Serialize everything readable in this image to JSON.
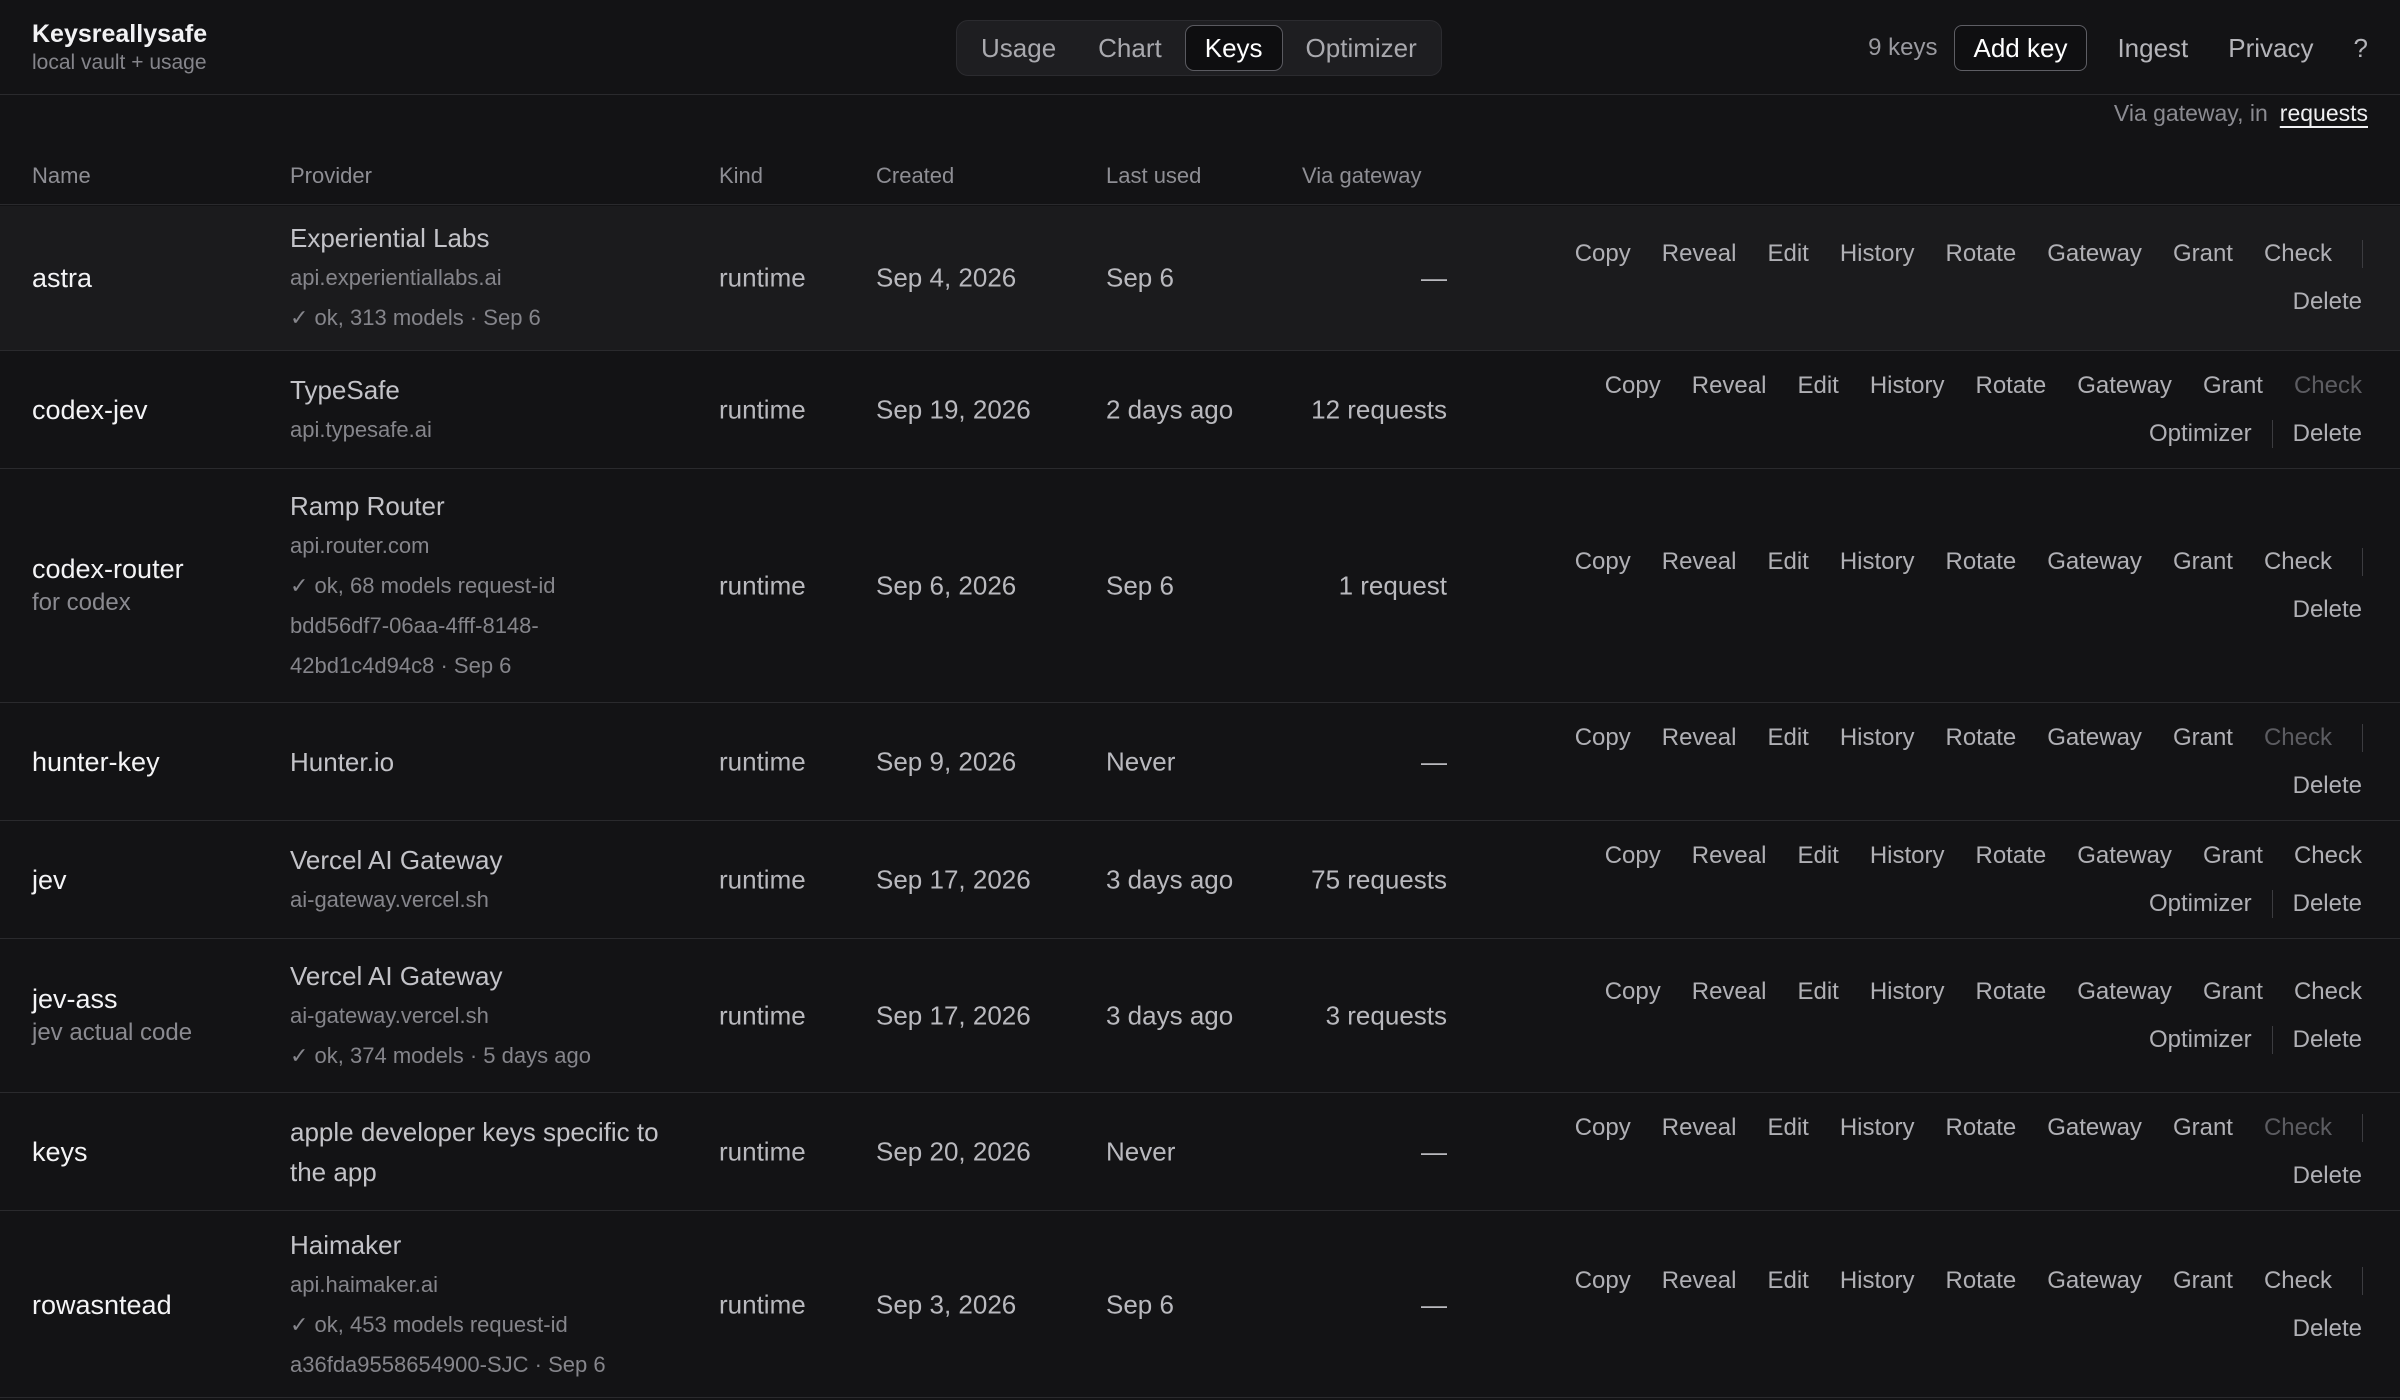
{
  "app": {
    "title": "Keysreallysafe",
    "subtitle": "local vault + usage"
  },
  "tabs": [
    {
      "label": "Usage",
      "active": false
    },
    {
      "label": "Chart",
      "active": false
    },
    {
      "label": "Keys",
      "active": true
    },
    {
      "label": "Optimizer",
      "active": false
    }
  ],
  "nav": {
    "key_count": "9 keys",
    "add_key": "Add key",
    "ingest": "Ingest",
    "privacy": "Privacy",
    "help": "?"
  },
  "gateway_hint": {
    "prefix": "Via gateway, in",
    "unit": "requests"
  },
  "columns": [
    "Name",
    "Provider",
    "Kind",
    "Created",
    "Last used",
    "Via gateway"
  ],
  "actions": {
    "copy": "Copy",
    "reveal": "Reveal",
    "edit": "Edit",
    "history": "History",
    "rotate": "Rotate",
    "gateway": "Gateway",
    "grant": "Grant",
    "check": "Check",
    "optimizer": "Optimizer",
    "delete": "Delete"
  },
  "rows": [
    {
      "name": "astra",
      "note": "",
      "provider": "Experiential Labs",
      "provider_lines": [
        "api.experientiallabs.ai",
        "✓ ok, 313 models · Sep 6"
      ],
      "kind": "runtime",
      "created": "Sep 4, 2026",
      "last_used": "Sep 6",
      "via": "—",
      "check_enabled": true,
      "optimizer": false
    },
    {
      "name": "codex-jev",
      "note": "",
      "provider": "TypeSafe",
      "provider_lines": [
        "api.typesafe.ai"
      ],
      "kind": "runtime",
      "created": "Sep 19, 2026",
      "last_used": "2 days ago",
      "via": "12 requests",
      "check_enabled": false,
      "optimizer": true
    },
    {
      "name": "codex-router",
      "note": "for codex",
      "provider": "Ramp Router",
      "provider_lines": [
        "api.router.com",
        "✓ ok, 68 models request-id",
        "bdd56df7-06aa-4fff-8148-",
        "42bd1c4d94c8 · Sep 6"
      ],
      "kind": "runtime",
      "created": "Sep 6, 2026",
      "last_used": "Sep 6",
      "via": "1 request",
      "check_enabled": true,
      "optimizer": false
    },
    {
      "name": "hunter-key",
      "note": "",
      "provider": "Hunter.io",
      "provider_lines": [],
      "kind": "runtime",
      "created": "Sep 9, 2026",
      "last_used": "Never",
      "via": "—",
      "check_enabled": false,
      "optimizer": false
    },
    {
      "name": "jev",
      "note": "",
      "provider": "Vercel AI Gateway",
      "provider_lines": [
        "ai-gateway.vercel.sh"
      ],
      "kind": "runtime",
      "created": "Sep 17, 2026",
      "last_used": "3 days ago",
      "via": "75 requests",
      "check_enabled": true,
      "optimizer": true
    },
    {
      "name": "jev-ass",
      "note": "jev actual code",
      "provider": "Vercel AI Gateway",
      "provider_lines": [
        "ai-gateway.vercel.sh",
        "✓ ok, 374 models · 5 days ago"
      ],
      "kind": "runtime",
      "created": "Sep 17, 2026",
      "last_used": "3 days ago",
      "via": "3 requests",
      "check_enabled": true,
      "optimizer": true
    },
    {
      "name": "keys",
      "note": "",
      "provider": "apple developer keys specific to the app",
      "provider_lines": [],
      "kind": "runtime",
      "created": "Sep 20, 2026",
      "last_used": "Never",
      "via": "—",
      "check_enabled": false,
      "optimizer": false
    },
    {
      "name": "rowasntead",
      "note": "",
      "provider": "Haimaker",
      "provider_lines": [
        "api.haimaker.ai",
        "✓ ok, 453 models request-id",
        "a36fda9558654900-SJC · Sep 6"
      ],
      "kind": "runtime",
      "created": "Sep 3, 2026",
      "last_used": "Sep 6",
      "via": "—",
      "check_enabled": true,
      "optimizer": false
    }
  ]
}
